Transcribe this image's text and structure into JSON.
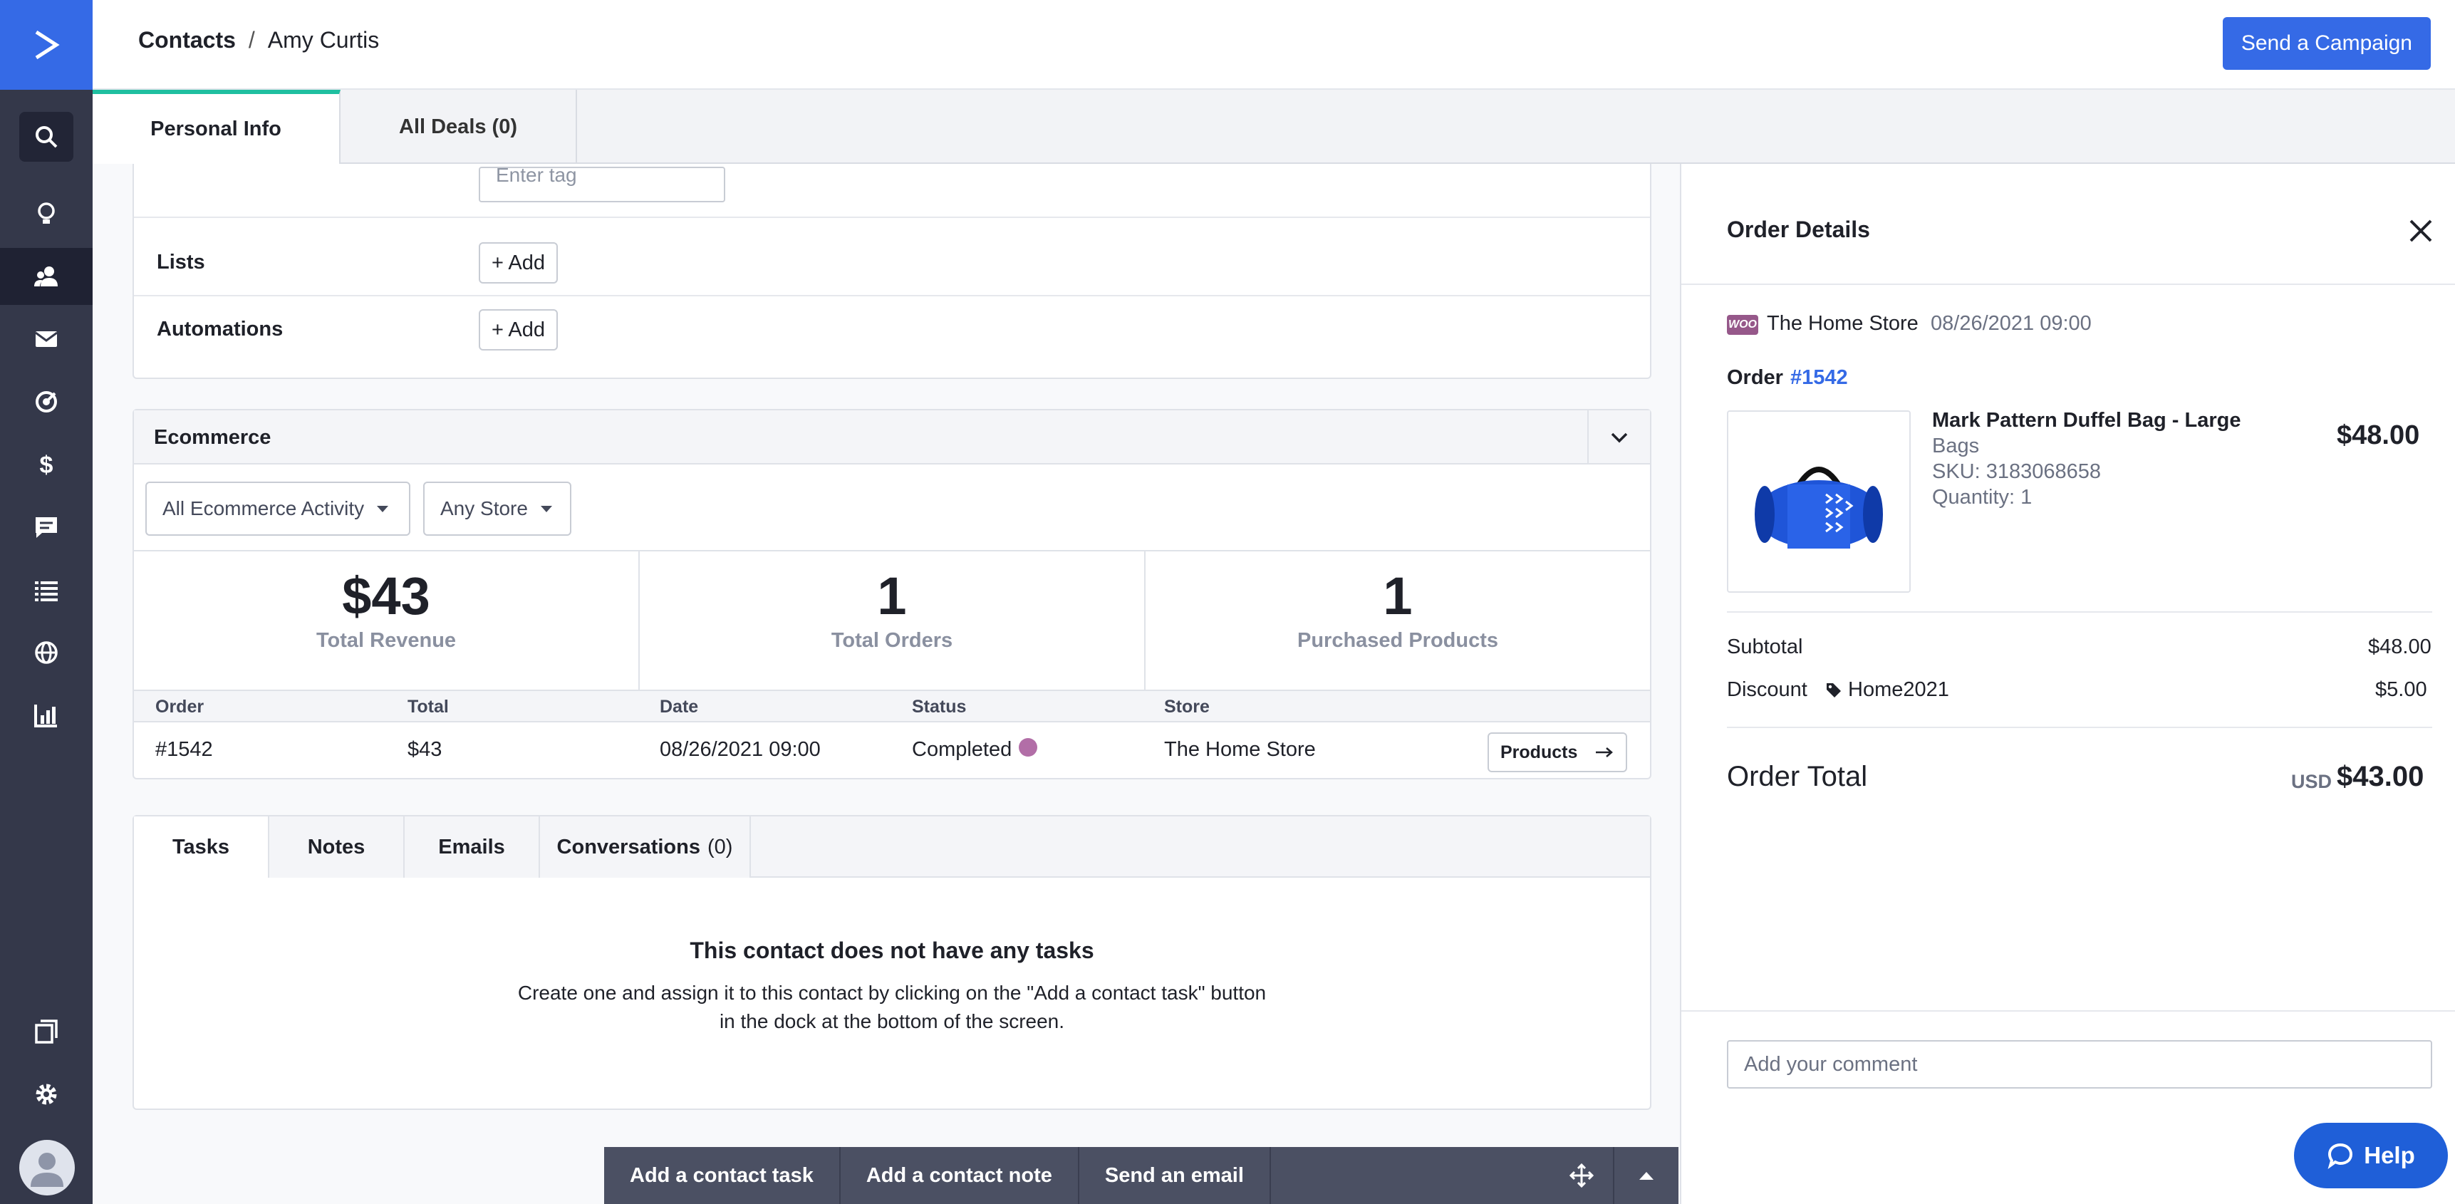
{
  "colors": {
    "accent": "#356ae6",
    "sidebar": "#34384a",
    "tab_active": "#1fbfa0",
    "woo": "#96588a"
  },
  "header": {
    "breadcrumb_root": "Contacts",
    "breadcrumb_sep": "/",
    "breadcrumb_current": "Amy Curtis",
    "campaign_button": "Send a Campaign"
  },
  "tabs": [
    {
      "label": "Personal Info",
      "active": true
    },
    {
      "label": "All Deals (0)",
      "active": false
    }
  ],
  "sidebar": {
    "icons": [
      "logo-chevron-icon",
      "search-icon",
      "lightbulb-icon",
      "contacts-icon",
      "envelope-icon",
      "automation-icon",
      "dollar-icon",
      "chat-icon",
      "list-icon",
      "globe-icon",
      "bar-chart-icon",
      "pages-icon",
      "gear-icon",
      "avatar-icon"
    ]
  },
  "details": {
    "tag_placeholder": "Enter tag",
    "lists_label": "Lists",
    "lists_button": "+ Add",
    "automations_label": "Automations",
    "automations_button": "+ Add"
  },
  "ecommerce": {
    "title": "Ecommerce",
    "filter_activity": "All Ecommerce Activity",
    "filter_store": "Any Store",
    "stats": [
      {
        "value": "$43",
        "label": "Total Revenue"
      },
      {
        "value": "1",
        "label": "Total Orders"
      },
      {
        "value": "1",
        "label": "Purchased Products"
      }
    ],
    "columns": [
      "Order",
      "Total",
      "Date",
      "Status",
      "Store"
    ],
    "rows": [
      {
        "order": "#1542",
        "total": "$43",
        "date": "08/26/2021 09:00",
        "status": "Completed",
        "store": "The Home Store",
        "action": "Products"
      }
    ]
  },
  "activity": {
    "tabs": [
      "Tasks",
      "Notes",
      "Emails",
      "Conversations"
    ],
    "conversations_count": "(0)",
    "empty_title": "This contact does not have any tasks",
    "empty_line1": "Create one and assign it to this contact by clicking on the \"Add a contact task\" button",
    "empty_line2": "in the dock at the bottom of the screen."
  },
  "dock": {
    "items": [
      "Add a contact task",
      "Add a contact note",
      "Send an email"
    ]
  },
  "order_details": {
    "title": "Order Details",
    "store_badge": "WOO",
    "store": "The Home Store",
    "datetime": "08/26/2021 09:00",
    "order_label": "Order",
    "order_number": "#1542",
    "product_name": "Mark Pattern Duffel Bag - Large",
    "product_category": "Bags",
    "product_sku": "SKU: 3183068658",
    "product_qty": "Quantity: 1",
    "product_price": "$48.00",
    "subtotal_label": "Subtotal",
    "subtotal_value": "$48.00",
    "discount_label": "Discount",
    "discount_code": "Home2021",
    "discount_value": "$5.00",
    "total_label": "Order Total",
    "total_currency": "USD",
    "total_value": "$43.00",
    "comment_placeholder": "Add your comment"
  },
  "help": {
    "label": "Help"
  }
}
